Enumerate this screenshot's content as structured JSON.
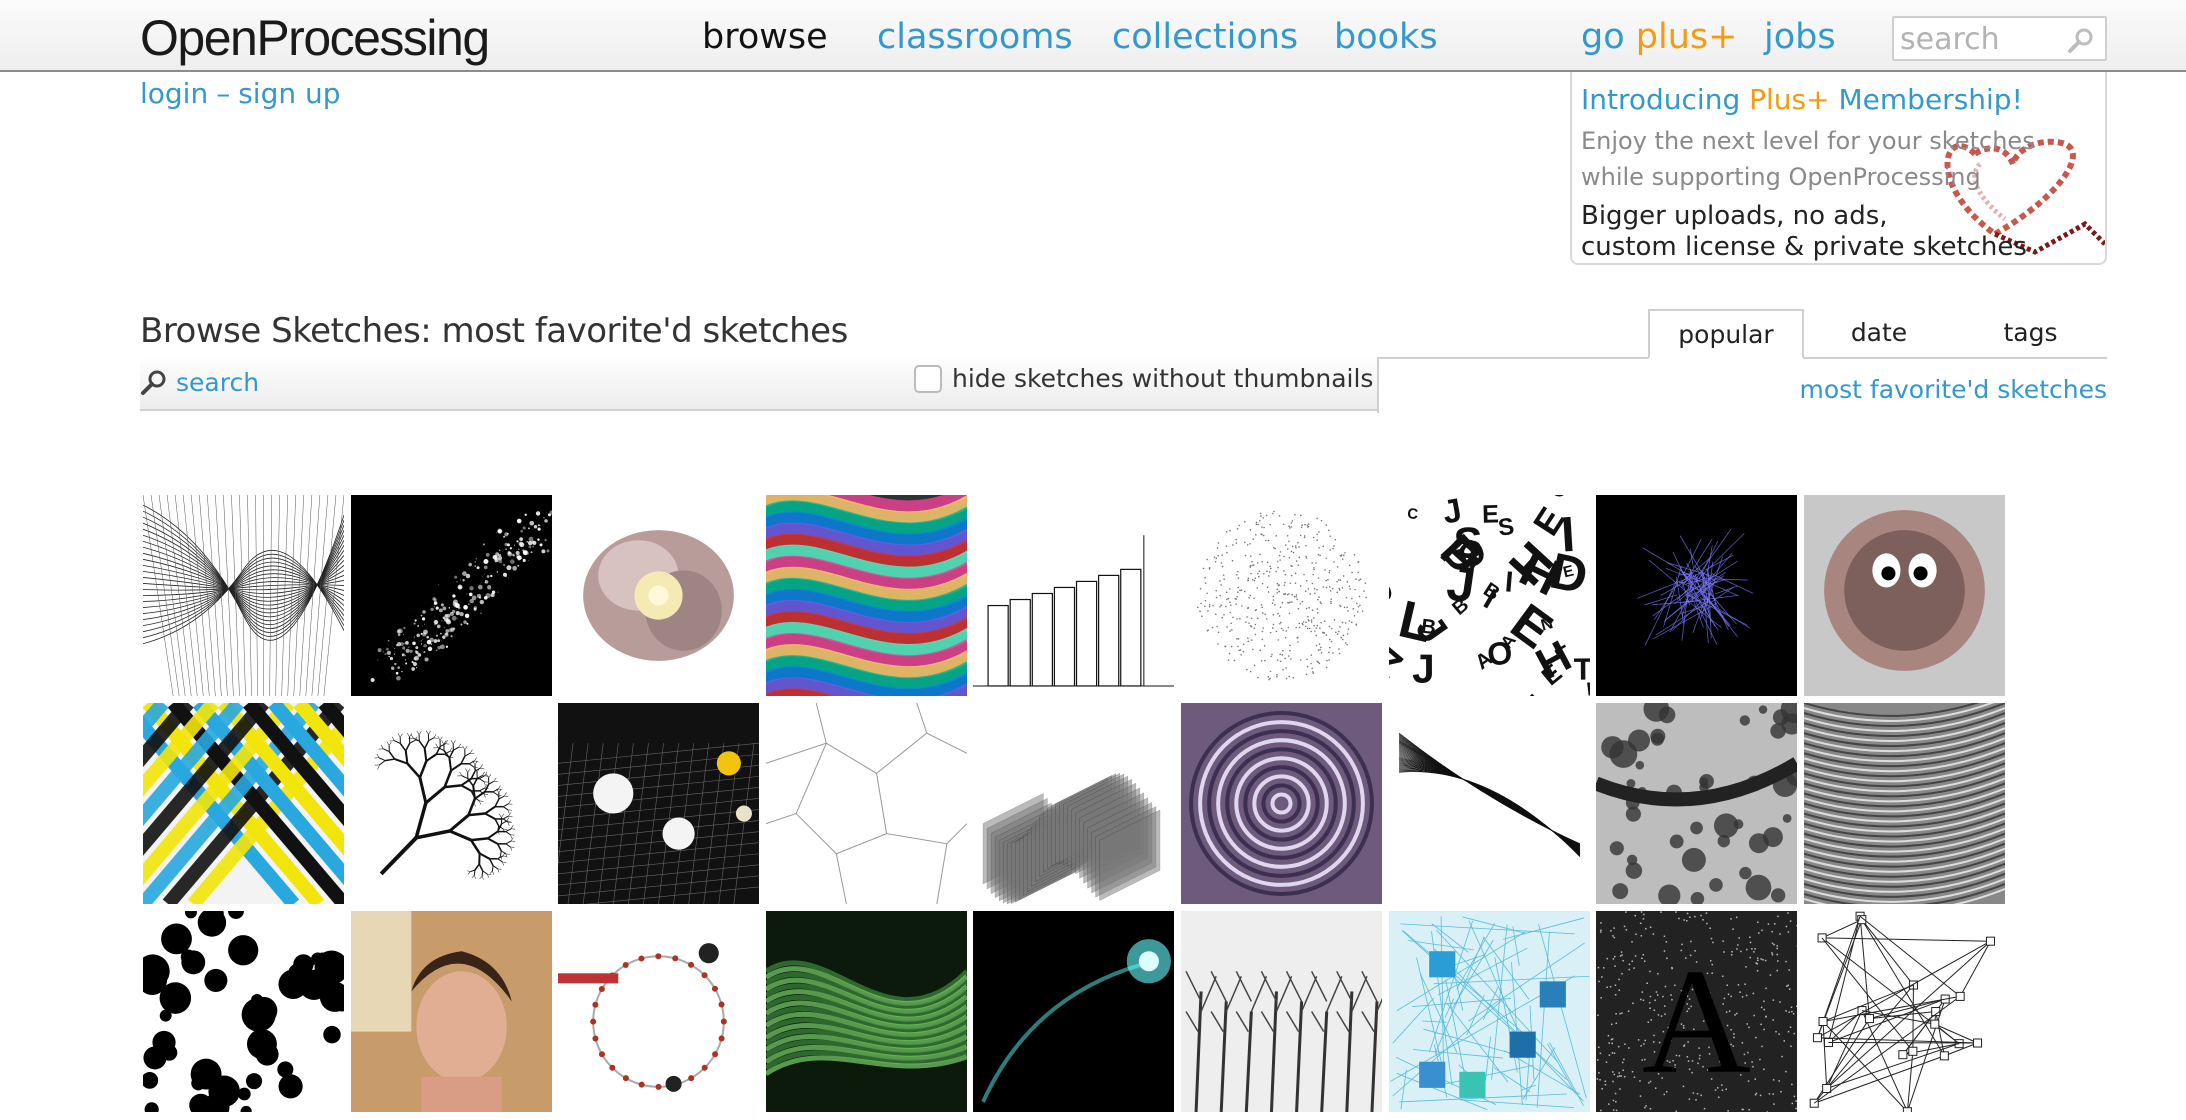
{
  "header": {
    "logo": "OpenProcessing",
    "nav": [
      "browse",
      "classrooms",
      "collections",
      "books"
    ],
    "go_label": "go",
    "plus_label": "plus+",
    "jobs_label": "jobs",
    "search_placeholder": "search"
  },
  "auth": {
    "login": "login",
    "separator": "–",
    "signup": "sign up"
  },
  "promo": {
    "title_prefix": "Introducing",
    "title_plus": "Plus+",
    "title_suffix": "Membership!",
    "line1": "Enjoy the next level for your sketches",
    "line2": "while supporting OpenProcessing",
    "feature1": "Bigger uploads, no ads,",
    "feature2": "custom license & private sketches"
  },
  "browse": {
    "title": "Browse Sketches: most favorite'd sketches",
    "search_label": "search",
    "filter_label": "hide sketches without thumbnails",
    "tabs": [
      "popular",
      "date",
      "tags"
    ],
    "sort_label": "most favorite'd sketches"
  },
  "colors": {
    "link": "#3399cc",
    "plus_accent": "#f39c12",
    "text": "#333333"
  },
  "thumbnails": [
    "wireframe-mesh",
    "particle-burst",
    "flower-render",
    "rainbow-flow",
    "architecture-lines",
    "dot-sphere",
    "typography",
    "blue-tangle",
    "furry-creature",
    "cross-stripes",
    "fractal-branches",
    "spheres-grid",
    "voronoi-cells",
    "wave-bars",
    "mandala",
    "web-strands",
    "reaction-diffusion",
    "grayscale-waves",
    "black-blobs",
    "portrait-photo",
    "orbit-diagram",
    "green-smoke",
    "cyan-comet",
    "bare-trees",
    "cubes-network",
    "ascii-letter",
    "line-network"
  ]
}
